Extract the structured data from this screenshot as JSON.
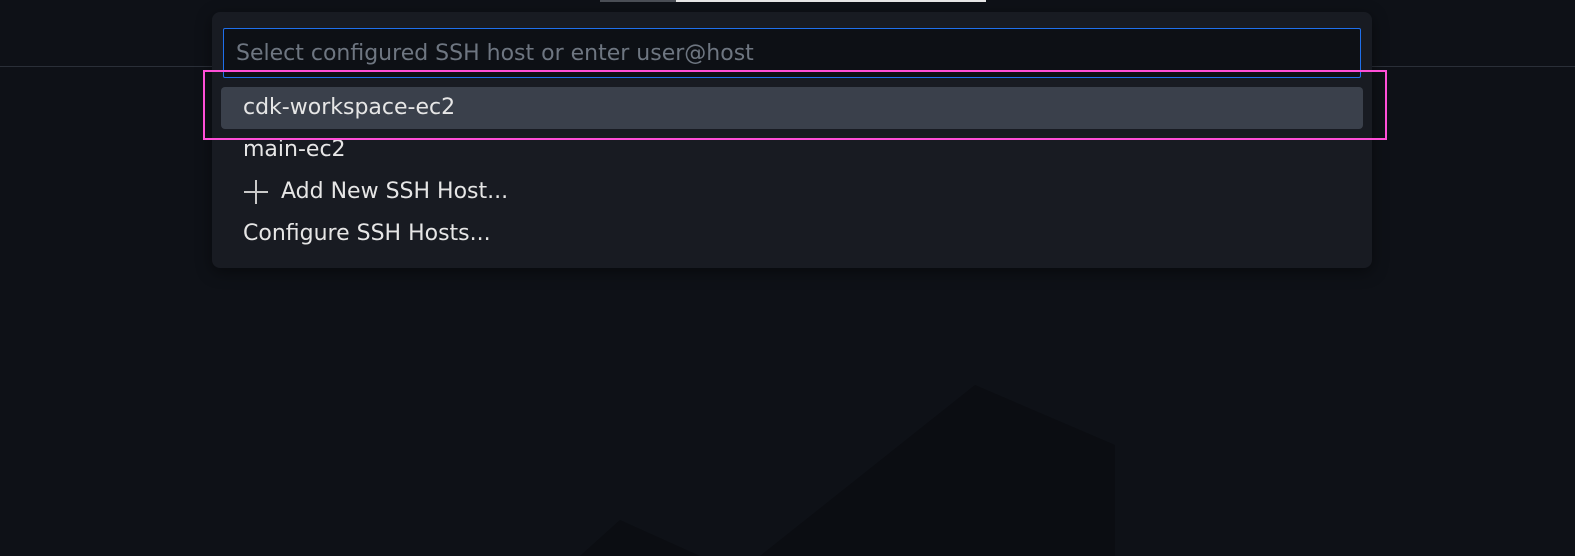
{
  "quick_pick": {
    "input_placeholder": "Select configured SSH host or enter user@host",
    "input_value": "",
    "items": [
      {
        "label": "cdk-workspace-ec2",
        "active": true,
        "icon": ""
      },
      {
        "label": "main-ec2",
        "active": false,
        "icon": ""
      },
      {
        "label": "Add New SSH Host...",
        "active": false,
        "icon": "plus-icon"
      },
      {
        "label": "Configure SSH Hosts...",
        "active": false,
        "icon": ""
      }
    ]
  },
  "colors": {
    "background": "#0e1117",
    "panel": "#181b22",
    "input_border": "#1f6feb",
    "active_item": "#3a404b",
    "highlight": "#ff4fd8"
  }
}
